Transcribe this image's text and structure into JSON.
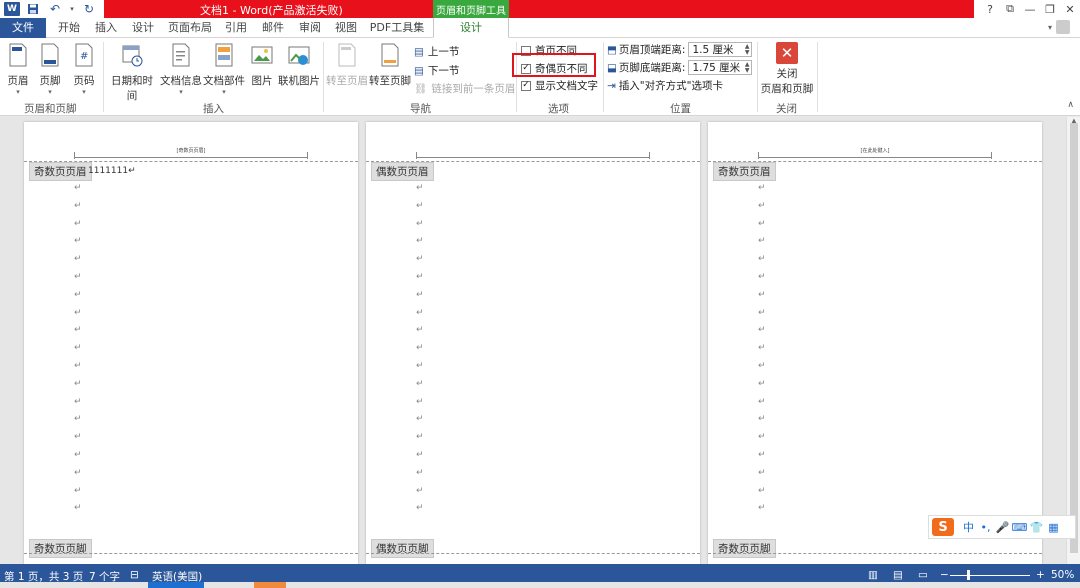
{
  "app": {
    "title": "文档1 - Word(产品激活失败)",
    "context_tab_group": "页眉和页脚工具",
    "logo_letter": "W"
  },
  "window_controls": {
    "help": "?",
    "ribbon_opts": "⧉",
    "minimize": "—",
    "restore": "❐",
    "close": "✕"
  },
  "tabs": [
    "文件",
    "开始",
    "插入",
    "设计",
    "页面布局",
    "引用",
    "邮件",
    "审阅",
    "视图",
    "PDF工具集"
  ],
  "active_tab": "设计",
  "ribbon": {
    "hf_group": {
      "header": "页眉",
      "footer": "页脚",
      "page_num": "页码",
      "label": "页眉和页脚"
    },
    "insert_group": {
      "date_time": "日期和时间",
      "doc_info": "文档信息",
      "doc_parts": "文档部件",
      "picture": "图片",
      "online_picture": "联机图片",
      "label": "插入"
    },
    "nav_group": {
      "goto_header": "转至页眉",
      "goto_footer": "转至页脚",
      "prev_section": "上一节",
      "next_section": "下一节",
      "link_prev": "链接到前一条页眉",
      "label": "导航"
    },
    "options_group": {
      "first_page_diff": "首页不同",
      "first_page_checked": false,
      "odd_even_diff": "奇偶页不同",
      "odd_even_checked": true,
      "show_doc_text": "显示文档文字",
      "show_doc_text_checked": true,
      "label": "选项"
    },
    "position_group": {
      "header_top_label": "页眉顶端距离:",
      "header_top_value": "1.5 厘米",
      "footer_bottom_label": "页脚底端距离:",
      "footer_bottom_value": "1.75 厘米",
      "insert_align_tab": "插入\"对齐方式\"选项卡",
      "label": "位置"
    },
    "close_group": {
      "close_line1": "关闭",
      "close_line2": "页眉和页脚",
      "label": "关闭"
    }
  },
  "pages": [
    {
      "header_text": "[奇数页页眉]",
      "header_tag": "奇数页页眉",
      "footer_tag": "奇数页页脚",
      "body_text": "1111111↵"
    },
    {
      "header_text": "",
      "header_tag": "偶数页页眉",
      "footer_tag": "偶数页页脚",
      "body_text": ""
    },
    {
      "header_text": "[在此处键入]",
      "header_tag": "奇数页页眉",
      "footer_tag": "奇数页页脚",
      "body_text": ""
    }
  ],
  "paragraph_mark": "↵",
  "status": {
    "page": "第 1 页，共 3 页",
    "words": "7 个字",
    "language": "英语(美国)",
    "zoom": "50%",
    "zoom_minus": "−",
    "zoom_plus": "+"
  },
  "ime": {
    "logo": "S",
    "items": [
      "中",
      "•,",
      "🎤",
      "⌨",
      "👕",
      "▦"
    ]
  },
  "colors": {
    "accent_blue": "#2b579a",
    "title_red": "#e8101a",
    "context_green": "#39a83e",
    "highlight_red": "#e0151c"
  }
}
